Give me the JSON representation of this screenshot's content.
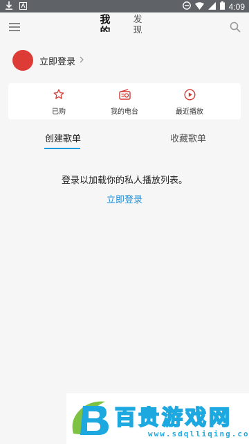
{
  "status_bar": {
    "time": "4:09",
    "colors": {
      "bg": "#5f6368"
    }
  },
  "header": {
    "tab_me": "我的",
    "tab_find": "发现"
  },
  "login": {
    "label": "立即登录"
  },
  "quick": [
    {
      "label": "已购",
      "icon": "star-icon"
    },
    {
      "label": "我的电台",
      "icon": "radio-icon"
    },
    {
      "label": "最近播放",
      "icon": "play-circle-icon"
    }
  ],
  "playlist_tabs": {
    "created": "创建歌单",
    "collected": "收藏歌单"
  },
  "empty": {
    "message": "登录以加载你的私人播放列表。",
    "link": "立即登录"
  },
  "watermark": {
    "title": "百贵游戏网",
    "url": "www.sdqlliqing.com"
  },
  "colors": {
    "accent": "#dc3c35",
    "link": "#1a8fd8",
    "tab_underline": "#1a9be0"
  }
}
